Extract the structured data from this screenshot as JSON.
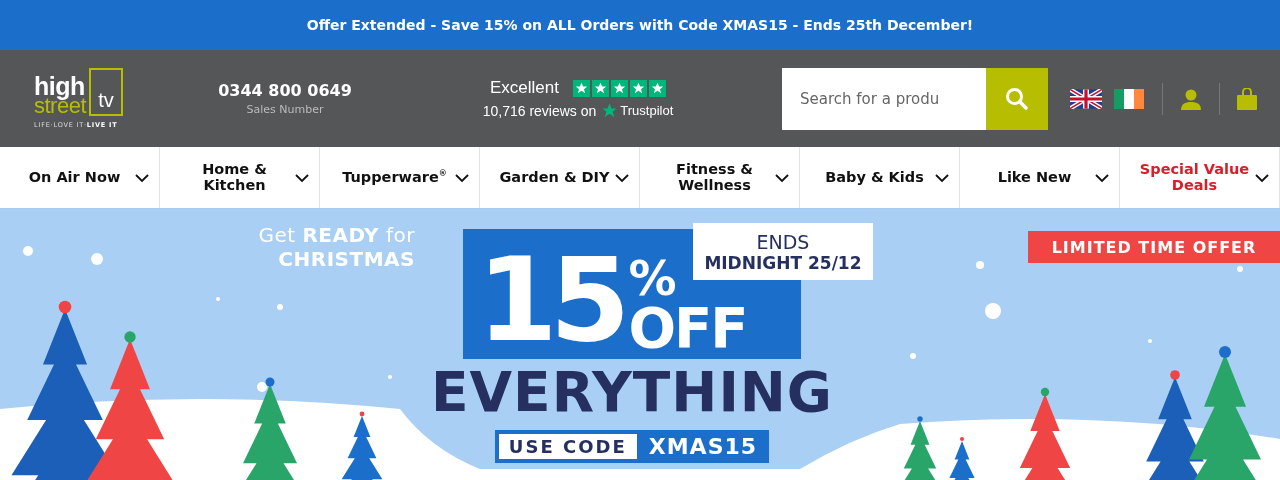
{
  "promo_bar": {
    "text": "Offer Extended - Save 15% on ALL Orders with Code XMAS15 - Ends 25th December!"
  },
  "header": {
    "logo": {
      "line_1": "high",
      "line_2": "street",
      "badge": "tv",
      "tagline": "LIFE·LOVE IT·**LIVE IT**"
    },
    "phone": {
      "number": "0344 800 0649",
      "caption": "Sales Number"
    },
    "rating": {
      "label": "Excellent",
      "stars": 5,
      "reviews": "10,716 reviews on",
      "brand": "Trustpilot"
    },
    "search": {
      "placeholder": "Search for a produ"
    }
  },
  "nav": [
    {
      "label": "On Air Now",
      "kind": "category"
    },
    {
      "label": "Home & Kitchen",
      "kind": "category"
    },
    {
      "label": "Tupperware$^{®}$",
      "kind": "category"
    },
    {
      "label": "Garden & DIY",
      "kind": "category"
    },
    {
      "label": "Fitness & Wellness",
      "kind": "category"
    },
    {
      "label": "Baby & Kids",
      "kind": "category"
    },
    {
      "label": "Like New",
      "kind": "category"
    },
    {
      "label": "Special Value Deals",
      "kind": "sale"
    }
  ],
  "banner": {
    "kicker_1": "Get **READY** for",
    "kicker_2": "CHRISTMAS",
    "amount": "15",
    "percent": "%",
    "off": "OFF",
    "ends_1": "ENDS",
    "ends_2": "MIDNIGHT 25/12",
    "headline": "EVERYTHING",
    "code_label": "USE CODE",
    "code": "XMAS15",
    "badge": "LIMITED TIME OFFER"
  }
}
